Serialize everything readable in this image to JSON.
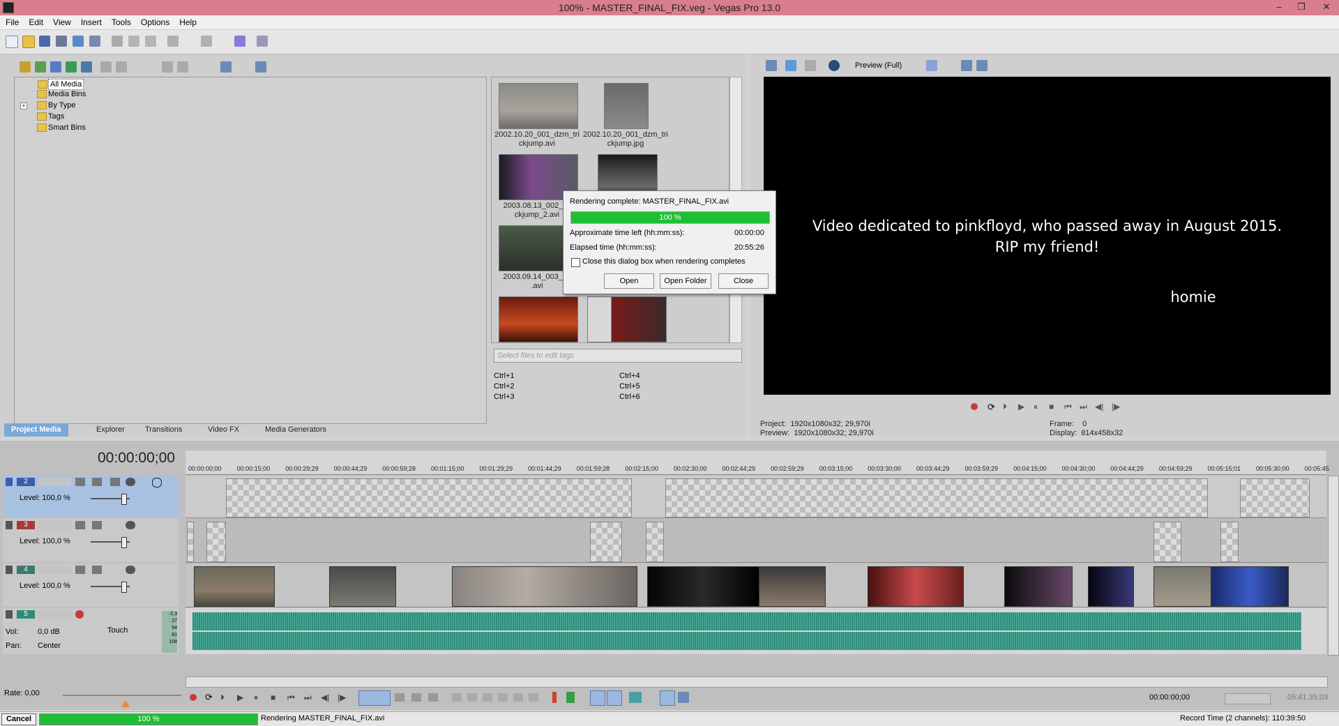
{
  "window": {
    "title": "100% - MASTER_FINAL_FIX.veg - Vegas Pro 13.0",
    "minimize": "–",
    "maximize": "❐",
    "close": "✕"
  },
  "menu": [
    "File",
    "Edit",
    "View",
    "Insert",
    "Tools",
    "Options",
    "Help"
  ],
  "media_tree": {
    "items": [
      "All Media",
      "Media Bins",
      "By Type",
      "Tags",
      "Smart Bins"
    ]
  },
  "media_files": [
    {
      "name": "2002.10.20_001_dzm_trickjump.avi",
      "line1": "2002.10.20_001_dzm_tri",
      "line2": "ckjump.avi"
    },
    {
      "name": "2002.10.20_001_dzm_trickjump.jpg",
      "line1": "2002.10.20_001_dzm_tri",
      "line2": "ckjump.jpg"
    },
    {
      "name": "2003.08.13_002_trickjump_2.avi",
      "line1": "2003.08.13_002_(A",
      "line2": "ckjump_2.avi"
    },
    {
      "name": "2003.09.14_003_tj.avi",
      "line1": "2003.09.14_003_tj3",
      "line2": ".avi"
    }
  ],
  "tags": {
    "placeholder": "Select files to edit tags",
    "shortcuts": [
      "Ctrl+1",
      "Ctrl+2",
      "Ctrl+3",
      "Ctrl+4",
      "Ctrl+5",
      "Ctrl+6"
    ]
  },
  "bottom_tabs": [
    "Project Media",
    "Explorer",
    "Transitions",
    "Video FX",
    "Media Generators"
  ],
  "preview": {
    "mode": "Preview (Full)",
    "line1": "Video dedicated to pinkfloyd, who passed away in August 2015.",
    "line2": "RIP my friend!",
    "line3": "homie",
    "project_label": "Project:",
    "project_value": "1920x1080x32; 29,970i",
    "preview_label": "Preview:",
    "preview_value": "1920x1080x32; 29,970i",
    "frame_label": "Frame:",
    "frame_value": "0",
    "display_label": "Display:",
    "display_value": "814x458x32"
  },
  "dialog": {
    "status": "Rendering complete: MASTER_FINAL_FIX.avi",
    "progress_text": "100 %",
    "progress": 1.0,
    "time_left_label": "Approximate time left (hh:mm:ss):",
    "time_left_value": "00:00:00",
    "elapsed_label": "Elapsed time (hh:mm:ss):",
    "elapsed_value": "20:55:26",
    "checkbox_label": "Close this dialog box when rendering completes",
    "open": "Open",
    "open_folder": "Open Folder",
    "close": "Close"
  },
  "timeline": {
    "timecode": "00:00:00;00",
    "ruler": [
      "00:00:00;00",
      "00:00:15;00",
      "00:00:29;29",
      "00:00:44;29",
      "00:00:59;28",
      "00:01:15;00",
      "00:01:29;29",
      "00:01:44;29",
      "00:01:59;28",
      "00:02:15;00",
      "00:02:30;00",
      "00:02:44;29",
      "00:02:59;29",
      "00:03:15;00",
      "00:03:30;00",
      "00:03:44;29",
      "00:03:59;29",
      "00:04:15;00",
      "00:04:30;00",
      "00:04:44;29",
      "00:04:59;29",
      "00:05:15;01",
      "00:05:30;00",
      "00:05:45"
    ],
    "tracks": [
      {
        "number": "2",
        "level": "Level: 100,0 %",
        "color": "#3a5fa8"
      },
      {
        "number": "3",
        "level": "Level: 100,0 %",
        "color": "#a83a3a"
      },
      {
        "number": "4",
        "level": "Level: 100,0 %",
        "color": "#3a7a6a"
      }
    ],
    "audio": {
      "number": "5",
      "vol": "Vol:",
      "vol_value": "0,0 dB",
      "pan": "Pan:",
      "pan_value": "Center",
      "mode": "Touch",
      "meter": [
        "-2,3",
        "27",
        "54",
        "81",
        "108"
      ]
    },
    "rate": "Rate: 0,00",
    "time_display": "00:00:00;00",
    "end_time": "05:41:35;03"
  },
  "status": {
    "cancel": "Cancel",
    "progress_text": "100 %",
    "progress": 1.0,
    "message": "Rendering MASTER_FINAL_FIX.avi",
    "record_time": "Record Time (2 channels): 110:39:50"
  },
  "colors": {
    "title_bg": "#d97e8c",
    "progress": "#1fbf35",
    "audio_wave": "#2d8b7a",
    "selected_track": "#a9c1e0"
  }
}
